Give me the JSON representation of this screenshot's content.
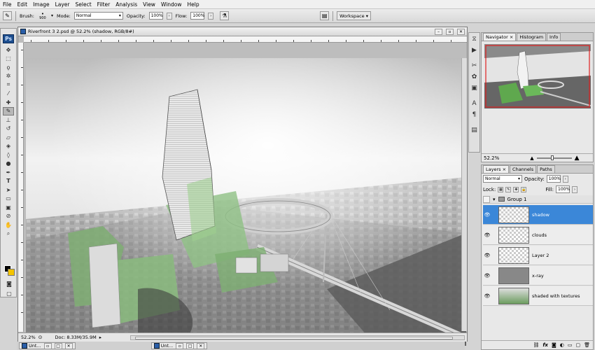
{
  "menubar": [
    "File",
    "Edit",
    "Image",
    "Layer",
    "Select",
    "Filter",
    "Analysis",
    "View",
    "Window",
    "Help"
  ],
  "options": {
    "brush_label": "Brush:",
    "brush_size": "900",
    "mode_label": "Mode:",
    "mode_value": "Normal",
    "opacity_label": "Opacity:",
    "opacity_value": "100%",
    "flow_label": "Flow:",
    "flow_value": "100%",
    "workspace_label": "Workspace"
  },
  "toolbox": {
    "logo": "Ps"
  },
  "document": {
    "title": "Riverfront 3 2.psd @ 52.2% (shadow, RGB/8#)",
    "zoom": "52.2%",
    "doc_size": "Doc: 8.33M/35.9M"
  },
  "taskbar": [
    "Unt...",
    "Unt..."
  ],
  "navigator": {
    "tabs": [
      "Navigator",
      "Histogram",
      "Info"
    ],
    "zoom": "52.2%"
  },
  "layers": {
    "tabs": [
      "Layers",
      "Channels",
      "Paths"
    ],
    "blend_mode": "Normal",
    "opacity_label": "Opacity:",
    "opacity_value": "100%",
    "lock_label": "Lock:",
    "fill_label": "Fill:",
    "fill_value": "100%",
    "group_name": "Group 1",
    "items": [
      {
        "name": "shadow",
        "selected": true
      },
      {
        "name": "clouds",
        "selected": false
      },
      {
        "name": "Layer 2",
        "selected": false
      },
      {
        "name": "x-ray",
        "selected": false
      },
      {
        "name": "shaded with textures",
        "selected": false
      }
    ],
    "footer_icons": [
      "link-icon",
      "fx-icon",
      "mask-icon",
      "adjustment-icon",
      "folder-icon",
      "new-layer-icon",
      "trash-icon"
    ]
  },
  "colors": {
    "selection": "#3b87d8",
    "foreground": "#000000",
    "background": "#f4c400",
    "nav_frame": "#e02020"
  }
}
